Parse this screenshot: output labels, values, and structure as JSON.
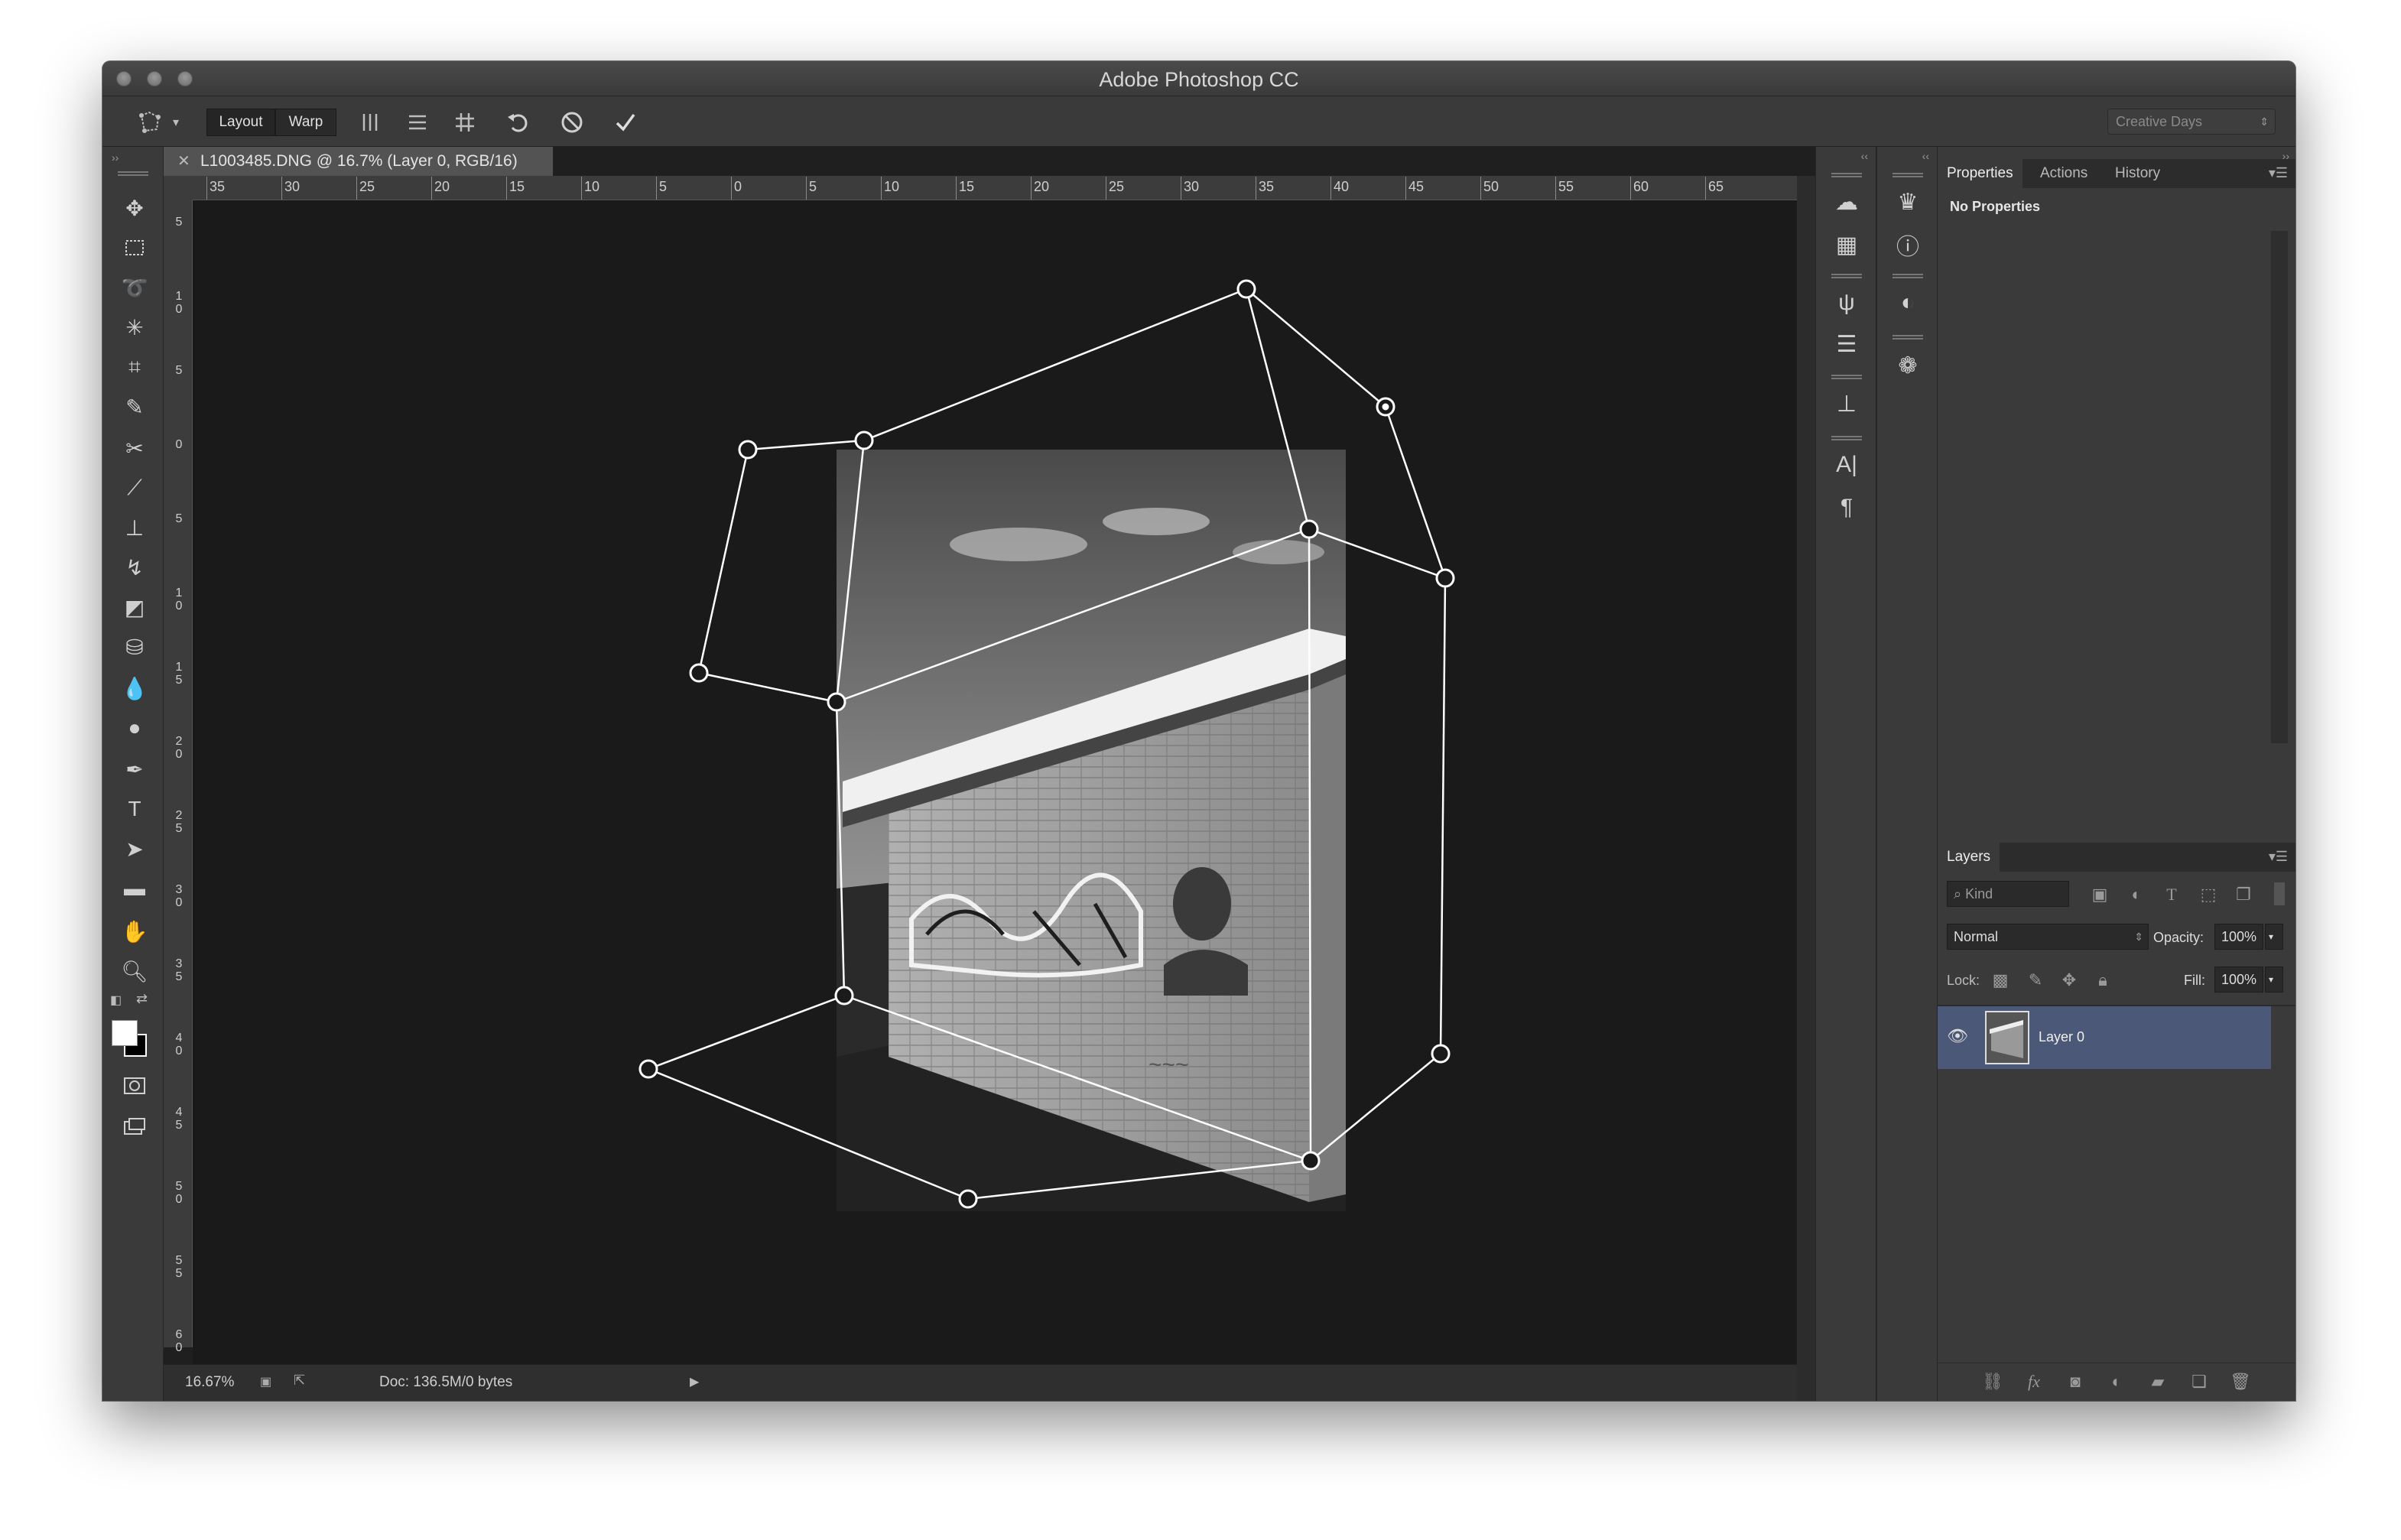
{
  "window": {
    "title": "Adobe Photoshop CC"
  },
  "options_bar": {
    "layout_label": "Layout",
    "warp_label": "Warp",
    "workspace": "Creative Days",
    "icons": [
      "puppet-tool-icon",
      "split-vertical-icon",
      "split-horizontal-icon",
      "grid-icon",
      "undo-icon",
      "cancel-icon",
      "commit-icon"
    ]
  },
  "document": {
    "tab_title": "L1003485.DNG @ 16.7% (Layer 0, RGB/16)",
    "ruler_top": [
      "35",
      "30",
      "25",
      "20",
      "15",
      "10",
      "5",
      "0",
      "5",
      "10",
      "15",
      "20",
      "25",
      "30",
      "35",
      "40",
      "45",
      "50",
      "55",
      "60",
      "65"
    ],
    "ruler_left": [
      "5",
      "1\n0",
      "5",
      "0",
      "5",
      "1\n0",
      "1\n5",
      "2\n0",
      "2\n5",
      "3\n0",
      "3\n5",
      "4\n0",
      "4\n5",
      "5\n0",
      "5\n5",
      "6\n0"
    ]
  },
  "status_bar": {
    "zoom": "16.67%",
    "doc_info": "Doc: 136.5M/0 bytes"
  },
  "properties_panel": {
    "tabs": [
      "Properties",
      "Actions",
      "History"
    ],
    "active_tab": "Properties",
    "message": "No Properties"
  },
  "layers_panel": {
    "title": "Layers",
    "filter_kind": "Kind",
    "blend_mode": "Normal",
    "opacity_label": "Opacity:",
    "opacity_value": "100%",
    "lock_label": "Lock:",
    "fill_label": "Fill:",
    "fill_value": "100%",
    "layers": [
      {
        "name": "Layer 0",
        "visible": true,
        "selected": true
      }
    ]
  }
}
